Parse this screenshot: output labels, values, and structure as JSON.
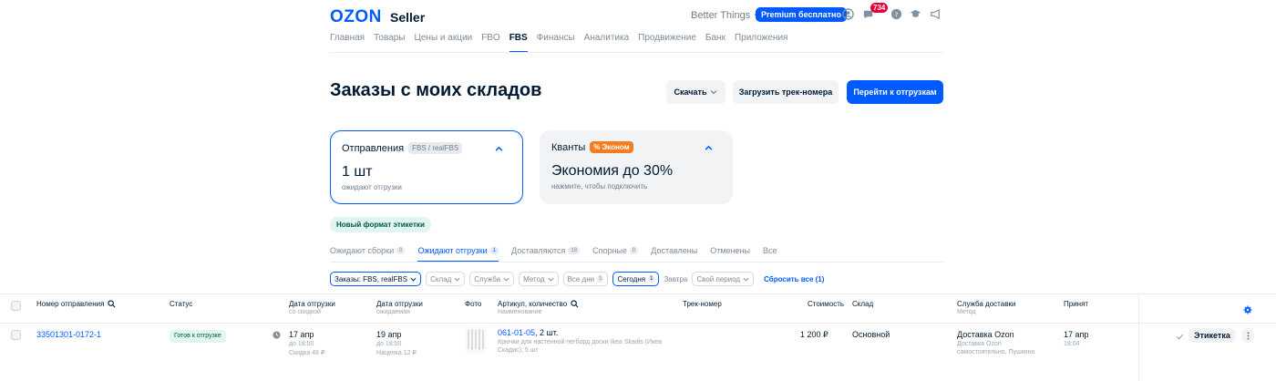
{
  "header": {
    "logo": "OZON",
    "logo_sub": "Seller",
    "store": "Better Things",
    "premium": "Premium бесплатно",
    "notifications": "734"
  },
  "nav": [
    "Главная",
    "Товары",
    "Цены и акции",
    "FBO",
    "FBS",
    "Финансы",
    "Аналитика",
    "Продвижение",
    "Банк",
    "Приложения"
  ],
  "nav_active_index": 4,
  "page": {
    "title": "Заказы с моих складов",
    "download": "Скачать",
    "upload_tracks": "Загрузить трек-номера",
    "go_shipments": "Перейти к отгрузкам"
  },
  "cards": {
    "shipments": {
      "title": "Отправления",
      "tag": "FBS / realFBS",
      "value": "1 шт",
      "note": "ожидают отгрузки"
    },
    "quants": {
      "title": "Кванты",
      "tag": "% Эконом",
      "value": "Экономия до 30%",
      "note": "нажмите, чтобы подключить"
    }
  },
  "new_label": "Новый формат этикетки",
  "tabs": [
    {
      "label": "Ожидают сборки",
      "count": "0"
    },
    {
      "label": "Ожидают отгрузки",
      "count": "1"
    },
    {
      "label": "Доставляются",
      "count": "18"
    },
    {
      "label": "Спорные",
      "count": "0"
    },
    {
      "label": "Доставлены",
      "count": ""
    },
    {
      "label": "Отменены",
      "count": ""
    },
    {
      "label": "Все",
      "count": ""
    }
  ],
  "filters": {
    "orders": "Заказы: FBS, realFBS",
    "warehouse": "Склад",
    "service": "Служба",
    "method": "Метод",
    "all_days": "Все дни",
    "all_days_count": "1",
    "today": "Сегодня",
    "today_count": "1",
    "tomorrow": "Завтра",
    "period": "Свой период",
    "reset": "Сбросить все (1)"
  },
  "columns": {
    "number": "Номер отправления",
    "status": "Статус",
    "ship_date": "Дата отгрузки",
    "ship_date_sub": "со скидкой",
    "ship_date2": "Дата отгрузки",
    "ship_date2_sub": "ожидаемая",
    "photo": "Фото",
    "article": "Артикул, количество",
    "article_sub": "Наименование",
    "track": "Трек-номер",
    "cost": "Стоимость",
    "warehouse": "Склад",
    "delivery": "Служба доставки",
    "delivery_sub": "Метод",
    "accepted": "Принят"
  },
  "row": {
    "number": "33501301-0172-1",
    "status": "Готов к отгрузке",
    "date1": "17 апр",
    "date1_time": "до 18:00",
    "date1_note": "Скидка 48 ₽",
    "date2": "19 апр",
    "date2_time": "до 18:00",
    "date2_note": "Наценка 12 ₽",
    "article": "061-01-05",
    "qty": ", 2 шт.",
    "name": "Крючки для настенной пегборд доски Ikea Skadis (Икеа Скадис), 5 шт",
    "cost": "1 200 ₽",
    "warehouse": "Основной",
    "delivery": "Доставка Ozon",
    "delivery_method": "Доставка Ozon самостоятельно, Пушкино",
    "accepted": "17 апр",
    "accepted_time": "19:04",
    "label_button": "Этикетка"
  },
  "colors": {
    "accent": "#005bff",
    "orange": "#f57d20",
    "green_bg": "#e1f5f3"
  }
}
